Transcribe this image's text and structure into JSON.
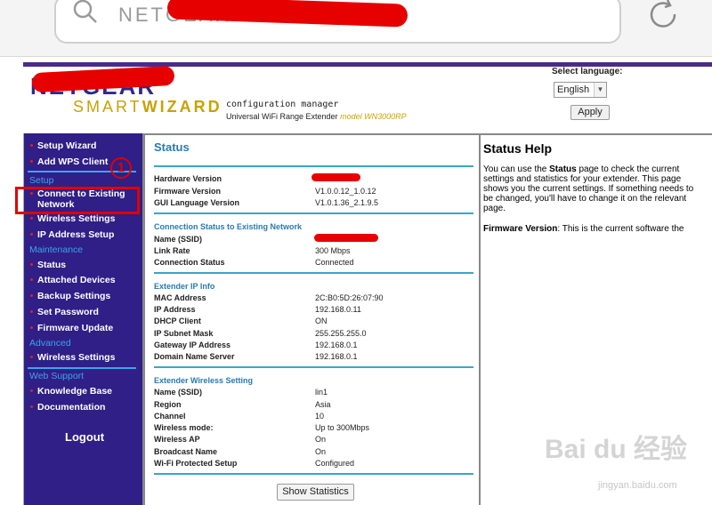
{
  "browser": {
    "url": "NETGEAR WN3000RP"
  },
  "header": {
    "logo": "NETGEAR",
    "smart": "SMART",
    "wizard": "WIZARD",
    "config_title": "configuration manager",
    "config_subtitle": "Universal WiFi Range Extender",
    "model": "model WN3000RP",
    "language_label": "Select language:",
    "language_value": "English",
    "apply_label": "Apply"
  },
  "sidebar": {
    "setup_wizard": "Setup Wizard",
    "add_wps": "Add WPS Client",
    "setup_head": "Setup",
    "connect_line1": "Connect to Existing",
    "connect_line2": "Network",
    "wireless_settings": "Wireless Settings",
    "ip_setup": "IP Address Setup",
    "maintenance_head": "Maintenance",
    "status": "Status",
    "attached": "Attached Devices",
    "backup": "Backup Settings",
    "password": "Set Password",
    "firmware": "Firmware Update",
    "advanced_head": "Advanced",
    "adv_wireless": "Wireless Settings",
    "support_head": "Web Support",
    "knowledge": "Knowledge Base",
    "documentation": "Documentation",
    "logout": "Logout",
    "annotation_number": "1"
  },
  "main": {
    "title": "Status",
    "hardware_label": "Hardware Version",
    "firmware_label": "Firmware Version",
    "firmware_value": "V1.0.0.12_1.0.12",
    "gui_label": "GUI Language Version",
    "gui_value": "V1.0.1.36_2.1.9.5",
    "conn_head": "Connection Status to Existing Network",
    "ssid_label": "Name (SSID)",
    "link_label": "Link Rate",
    "link_value": "300 Mbps",
    "connstatus_label": "Connection Status",
    "connstatus_value": "Connected",
    "ipinfo_head": "Extender IP Info",
    "mac_label": "MAC Address",
    "mac_value": "2C:B0:5D:26:07:90",
    "ip_label": "IP Address",
    "ip_value": "192.168.0.11",
    "dhcp_label": "DHCP Client",
    "dhcp_value": "ON",
    "mask_label": "IP Subnet Mask",
    "mask_value": "255.255.255.0",
    "gateway_label": "Gateway IP Address",
    "gateway_value": "192.168.0.1",
    "dns_label": "Domain Name Server",
    "dns_value": "192.168.0.1",
    "wireless_head": "Extender Wireless Setting",
    "wssid_label": "Name (SSID)",
    "wssid_value": "lin1",
    "region_label": "Region",
    "region_value": "Asia",
    "channel_label": "Channel",
    "channel_value": "10",
    "mode_label": "Wireless mode:",
    "mode_value": "Up to 300Mbps",
    "ap_label": "Wireless AP",
    "ap_value": "On",
    "broadcast_label": "Broadcast Name",
    "broadcast_value": "On",
    "wps_label": "Wi-Fi Protected Setup",
    "wps_value": "Configured",
    "stats_button": "Show Statistics"
  },
  "help": {
    "title": "Status Help",
    "p1_a": "You can use the ",
    "p1_b": "Status",
    "p1_c": " page to check the current settings and statistics for your extender. This page shows you the current settings. If something needs to be changed, you'll have to change it on the relevant page.",
    "p2_a": "Firmware Version",
    "p2_b": ": This is the current software the"
  },
  "watermark": {
    "logo": "Bai du 经验",
    "url": "jingyan.baidu.com"
  },
  "colors": {
    "sidebar_bg": "#2f1f86",
    "accent_blue": "#2a7ab0",
    "annotation_red": "#e00000"
  }
}
